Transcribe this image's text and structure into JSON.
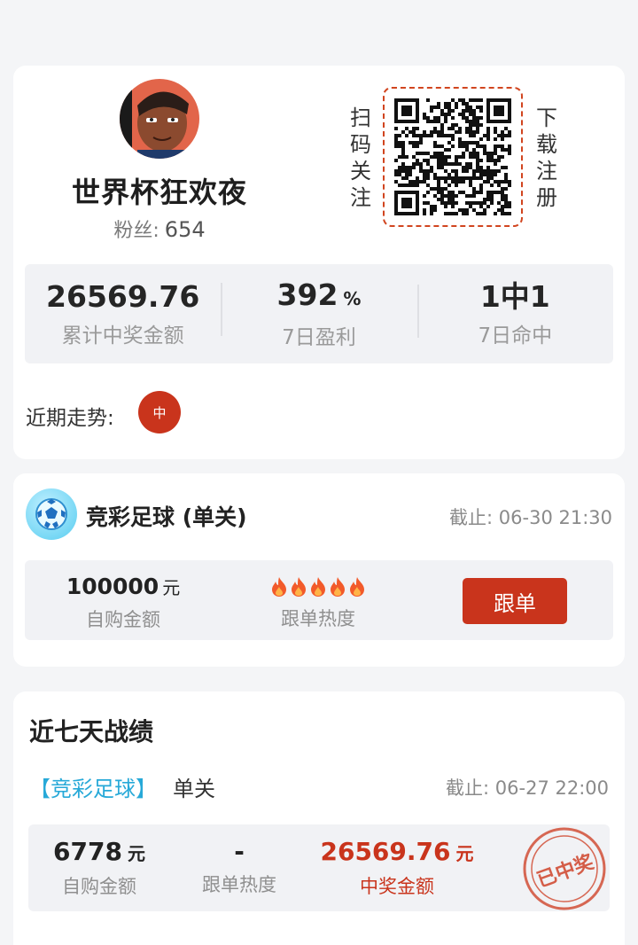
{
  "profile": {
    "nickname": "世界杯狂欢夜",
    "fans_label": "粉丝:",
    "fans_count": "654",
    "scan_label": "扫码关注",
    "download_label": "下载注册"
  },
  "stats": [
    {
      "value": "26569.76",
      "unit": "",
      "label": "累计中奖金额"
    },
    {
      "value": "392",
      "unit": "%",
      "label": "7日盈利"
    },
    {
      "value": "1中1",
      "unit": "",
      "label": "7日命中"
    }
  ],
  "trend": {
    "label": "近期走势:",
    "items": [
      "中"
    ]
  },
  "plan": {
    "title": "竞彩足球 (单关)",
    "deadline": "截止: 06-30 21:30",
    "amount": "100000",
    "amount_unit": "元",
    "amount_label": "自购金额",
    "heat_label": "跟单热度",
    "heat_level": 5,
    "follow_button": "跟单"
  },
  "record": {
    "title": "近七天战绩",
    "lottery": "【竞彩足球】",
    "play_type": "单关",
    "deadline": "截止: 06-27 22:00",
    "amount": "6778",
    "amount_unit": "元",
    "amount_label": "自购金额",
    "heat_value": "-",
    "heat_label": "跟单热度",
    "prize": "26569.76",
    "prize_unit": "元",
    "prize_label": "中奖金额",
    "stamp_text": "已中奖"
  },
  "colors": {
    "accent_red": "#c9341c",
    "accent_blue": "#27a9d8",
    "panel_gray": "#f1f2f5"
  }
}
